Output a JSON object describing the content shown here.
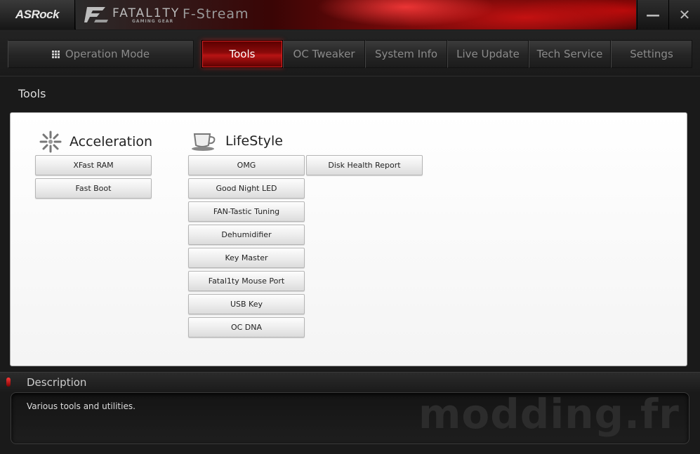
{
  "app": {
    "brand": "ASRock",
    "product_word": "FATAL1TY",
    "product_sub": "GAMING GEAR",
    "title": "F-Stream",
    "minimize_glyph": "—",
    "close_glyph": "✕"
  },
  "nav": {
    "operation_mode": "Operation Mode",
    "tabs": [
      {
        "label": "Tools",
        "active": true
      },
      {
        "label": "OC Tweaker",
        "active": false
      },
      {
        "label": "System Info",
        "active": false
      },
      {
        "label": "Live Update",
        "active": false
      },
      {
        "label": "Tech Service",
        "active": false
      },
      {
        "label": "Settings",
        "active": false
      }
    ]
  },
  "page": {
    "title": "Tools"
  },
  "groups": {
    "acceleration": {
      "title": "Acceleration",
      "icon": "sparkle-icon",
      "buttons": [
        "XFast RAM",
        "Fast Boot"
      ]
    },
    "lifestyle": {
      "title": "LifeStyle",
      "icon": "cup-icon",
      "buttons": [
        "OMG",
        "Good Night LED",
        "FAN-Tastic Tuning",
        "Dehumidifier",
        "Key Master",
        "Fatal1ty Mouse Port",
        "USB Key",
        "OC DNA"
      ],
      "buttons_col2": [
        "Disk Health Report"
      ]
    }
  },
  "description": {
    "title": "Description",
    "text": "Various tools and utilities."
  },
  "watermark": "modding.fr",
  "colors": {
    "accent": "#b81414",
    "background": "#1a1a1a",
    "panel": "#ffffff"
  }
}
